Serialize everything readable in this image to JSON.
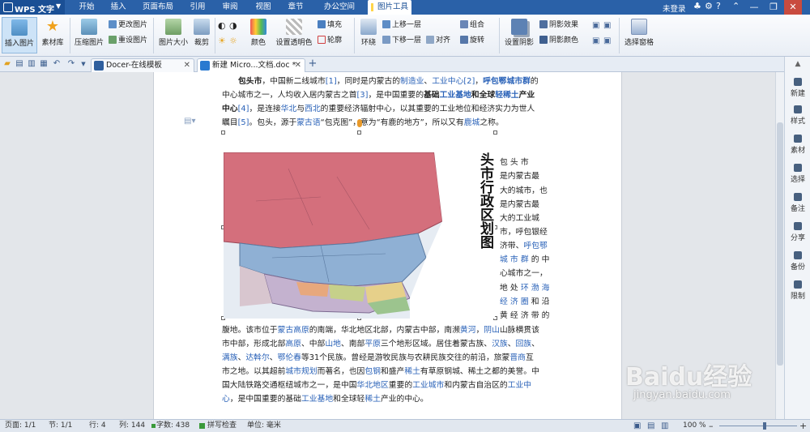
{
  "titlebar": {
    "app_title": "WPS 文字",
    "menu_tabs": [
      "开始",
      "插入",
      "页面布局",
      "引用",
      "审阅",
      "视图",
      "章节",
      "办公空间"
    ],
    "active_tab": "图片工具",
    "login": "未登录",
    "icons": [
      "skin-icon",
      "settings-icon",
      "help-icon",
      "ribbon-toggle-icon",
      "minimize-icon",
      "restore-icon",
      "close-icon"
    ]
  },
  "ribbon": {
    "insert_picture": "插入图片",
    "material_library": "素材库",
    "compress_picture": "压缩图片",
    "change_picture": "更改图片",
    "reset_picture": "重设图片",
    "picture_size": "图片大小",
    "crop": "裁剪",
    "color": "颜色",
    "set_transparent": "设置透明色",
    "fill": "填充",
    "outline": "轮廓",
    "wrap": "环绕",
    "bring_forward": "上移一层",
    "send_backward": "下移一层",
    "align": "对齐",
    "group": "组合",
    "rotate": "旋转",
    "set_shadow": "设置阴影",
    "shadow_effect": "阴影效果",
    "shadow_color": "阴影颜色",
    "selection_pane": "选择窗格"
  },
  "tabs": {
    "template_tab": "Docer-在线模板",
    "doc_tab": "新建 Micro...文档.doc *",
    "new_tab": "+"
  },
  "document": {
    "line1": [
      "包头市",
      "，中国新二线城市",
      "[1]",
      "，同时是内蒙古的",
      "制造业",
      "、",
      "工业中心",
      "[2]",
      "，",
      "呼包鄂城市群",
      "的"
    ],
    "line2": [
      "中心城市之一，人均收入居内蒙古之首",
      "[3]",
      "，是中国重要的",
      "基础",
      "工业基地",
      "和全球",
      "轻稀土",
      "产业"
    ],
    "line3": [
      "中心",
      "[4]",
      "，是连接",
      "华北",
      "与",
      "西北",
      "的重要经济辐射中心，以其重要的工业地位和经济实力为世人"
    ],
    "line4": [
      "瞩目",
      "[5]",
      "。包头，源于",
      "蒙古语",
      "“包克图”，意为“有鹿的地方”，所以又有",
      "鹿城",
      "之称。"
    ],
    "side_lines": [
      [
        "包 头 市"
      ],
      [
        "是内蒙古最"
      ],
      [
        "大的城市，也"
      ],
      [
        "是内蒙古最"
      ],
      [
        "大的工业城"
      ],
      [
        "市，呼包银经"
      ],
      [
        "济带、",
        "呼包鄂"
      ],
      [
        "城 市 群",
        " 的 中"
      ],
      [
        "心城市之一，"
      ],
      [
        "地 处 ",
        "环 渤 海"
      ],
      [
        "经 济 圈",
        " 和 沿"
      ],
      [
        "黄 经 济 带 的"
      ]
    ],
    "full_lines": [
      [
        "腹地。该市位于",
        "蒙古高原",
        "的南端，华北地区北部，内蒙古中部，南濒",
        "黄河",
        "，",
        "阴山",
        "山脉横贯该"
      ],
      [
        "市中部，形成北部",
        "高原",
        "、中部",
        "山地",
        "、南部",
        "平原",
        "三个地形区域。居住着蒙古族、",
        "汉族",
        "、",
        "回族",
        "、"
      ],
      [
        "满族",
        "、",
        "达斡尔",
        "、",
        "鄂伦春",
        "等31个民族。曾经是游牧民族与农耕民族交往的前沿，旅蒙",
        "晋商",
        "互"
      ],
      [
        "市之地。以其超前",
        "城市规划",
        "而著名，也因",
        "包钢",
        "和盛产",
        "稀土",
        "有草原钢城、稀土之都的美誉。中"
      ],
      [
        "国大陆铁路交通枢纽城市之一，是中国",
        "华北地区",
        "重要的",
        "工业城市",
        "和内蒙古自治区的",
        "工业中"
      ],
      [
        "心",
        "，是中国重要的基础",
        "工业基地",
        "和全球轻",
        "稀土",
        "产业的中心。"
      ]
    ],
    "map_title": "头市行政区划图"
  },
  "right_pane": [
    "新建",
    "样式",
    "素材",
    "选择",
    "备注",
    "分享",
    "备份",
    "限制"
  ],
  "status": {
    "page": "页面: 1/1",
    "section": "节: 1/1",
    "row": "行: 4",
    "col": "列: 144",
    "words": "字数: 438",
    "spell": "拼写检查",
    "unit": "单位: 毫米",
    "zoom": "100 %",
    "zoom_level": 1.0
  },
  "watermark": {
    "brand": "Baidu经验",
    "url": "jingyan.baidu.com"
  },
  "colors": {
    "titlebar": "#2a61a8",
    "link": "#2a62b8",
    "map_pink": "#d46f7c",
    "map_blue": "#8fb0d4"
  }
}
